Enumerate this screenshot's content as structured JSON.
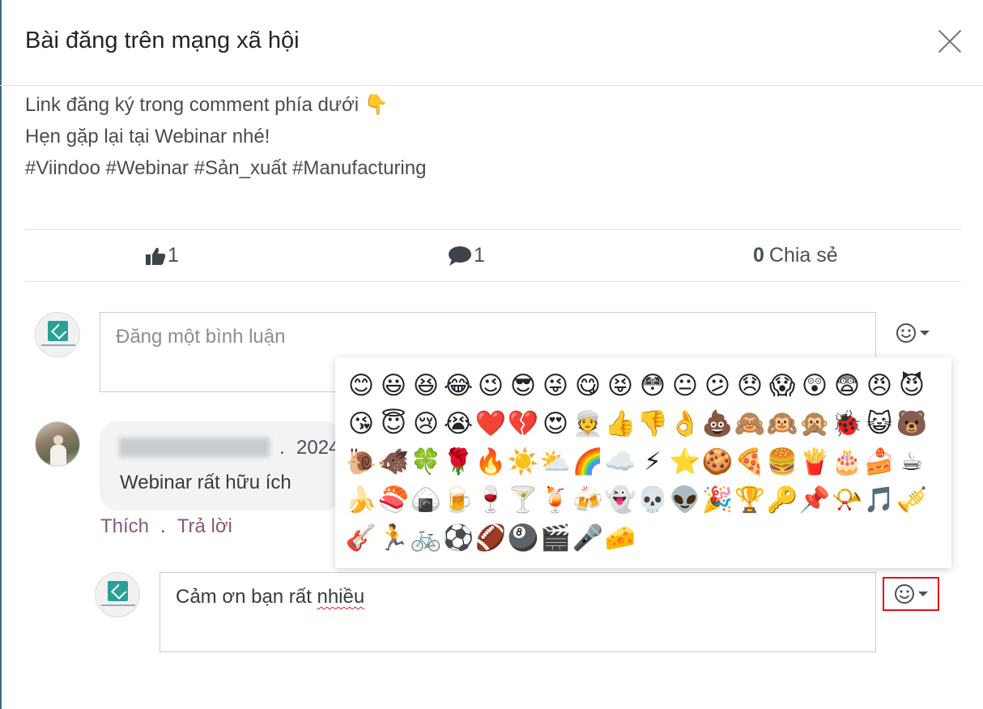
{
  "dialog": {
    "title": "Bài đăng trên mạng xã hội",
    "close_icon": "close-icon"
  },
  "post": {
    "lines": [
      "Link đăng ký trong comment phía dưới 👇",
      "Hẹn gặp lại tại Webinar nhé!",
      "#Viindoo #Webinar #Sản_xuất #Manufacturing"
    ]
  },
  "stats": {
    "likes": "1",
    "comments": "1",
    "shares_count": "0",
    "shares_label": "Chia sẻ",
    "like_icon": "thumbs-up-icon",
    "comment_icon": "comment-icon"
  },
  "new_comment": {
    "placeholder": "Đăng một bình luận"
  },
  "comment": {
    "date_partial": "2024",
    "dot": ".",
    "text": "Webinar rất hữu ích",
    "like_label": "Thích",
    "separator": ".",
    "reply_label": "Trả lời"
  },
  "reply": {
    "value_before": "Cảm ơn bạn rất ",
    "value_misspelled": "nhiều"
  },
  "emoji_picker": {
    "emojis": [
      "😊",
      "😃",
      "😆",
      "😂",
      "😉",
      "😎",
      "😜",
      "😋",
      "😝",
      "😳",
      "😐",
      "😕",
      "😞",
      "😱",
      "😲",
      "😨",
      "😠",
      "😈",
      "😘",
      "😇",
      "😢",
      "😭",
      "❤️",
      "💔",
      "😍",
      "👳",
      "👍",
      "👎",
      "👌",
      "💩",
      "🙈",
      "🙉",
      "🙊",
      "🐞",
      "😺",
      "🐻",
      "🐌",
      "🐗",
      "🍀",
      "🌹",
      "🔥",
      "☀️",
      "⛅",
      "🌈",
      "☁️",
      "⚡",
      "⭐",
      "🍪",
      "🍕",
      "🍔",
      "🍟",
      "🎂",
      "🍰",
      "☕",
      "🍌",
      "🍣",
      "🍙",
      "🍺",
      "🍷",
      "🍸",
      "🍹",
      "🍻",
      "👻",
      "💀",
      "👽",
      "🎉",
      "🏆",
      "🔑",
      "📌",
      "📯",
      "🎵",
      "🎺",
      "🎸",
      "🏃",
      "🚲",
      "⚽",
      "🏈",
      "🎱",
      "🎬",
      "🎤",
      "🧀"
    ]
  },
  "colors": {
    "link": "#875a7b",
    "highlight_border": "#e4101b",
    "brand_teal": "#2aa198"
  }
}
